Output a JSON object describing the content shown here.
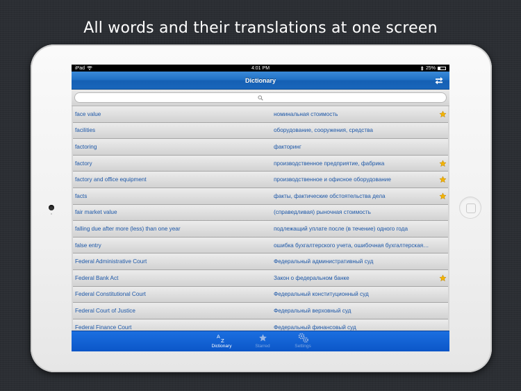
{
  "headline": "All words and their translations at one screen",
  "status_bar": {
    "device": "iPad",
    "time": "4:01 PM",
    "battery": "25%",
    "battery_level": 0.25
  },
  "nav_bar": {
    "title": "Dictionary",
    "swap_icon": "swap-arrows-icon"
  },
  "search": {
    "placeholder": "",
    "icon": "search-icon"
  },
  "colors": {
    "accent": "#1966bb",
    "link_text": "#1c57a8",
    "star": "#f4b400"
  },
  "entries": [
    {
      "word": "face value",
      "translation": "номинальная стоимость",
      "starred": true
    },
    {
      "word": "facilities",
      "translation": "оборудование, сооружения, средства",
      "starred": false
    },
    {
      "word": "factoring",
      "translation": "факторинг",
      "starred": false
    },
    {
      "word": "factory",
      "translation": "производственное предприятие, фабрика",
      "starred": true
    },
    {
      "word": "factory and office equipment",
      "translation": "производственное и офисное оборудование",
      "starred": true
    },
    {
      "word": "facts",
      "translation": "факты, фактические обстоятельства дела",
      "starred": true
    },
    {
      "word": "fair market value",
      "translation": "(справедливая) рыночная стоимость",
      "starred": false
    },
    {
      "word": "falling due after more (less) than one year",
      "translation": "подлежащий уплате после (в течение) одного года",
      "starred": false
    },
    {
      "word": "false entry",
      "translation": "ошибка бухгалтерского учета, ошибочная бухгалтерская…",
      "starred": false
    },
    {
      "word": "Federal Administrative Court",
      "translation": "Федеральный административный суд",
      "starred": false
    },
    {
      "word": "Federal Bank Act",
      "translation": "Закон о федеральном банке",
      "starred": true
    },
    {
      "word": "Federal Constitutional Court",
      "translation": "Федеральный конституционный суд",
      "starred": false
    },
    {
      "word": "Federal Court of Justice",
      "translation": "Федеральный верховный суд",
      "starred": false
    },
    {
      "word": "Federal Finance Court",
      "translation": "Федеральный финансовый суд",
      "starred": false
    }
  ],
  "tab_bar": {
    "tabs": [
      {
        "label": "Dictionary",
        "icon": "az-icon",
        "active": true
      },
      {
        "label": "Starred",
        "icon": "star-icon",
        "active": false
      },
      {
        "label": "Settings",
        "icon": "gears-icon",
        "active": false
      }
    ]
  }
}
